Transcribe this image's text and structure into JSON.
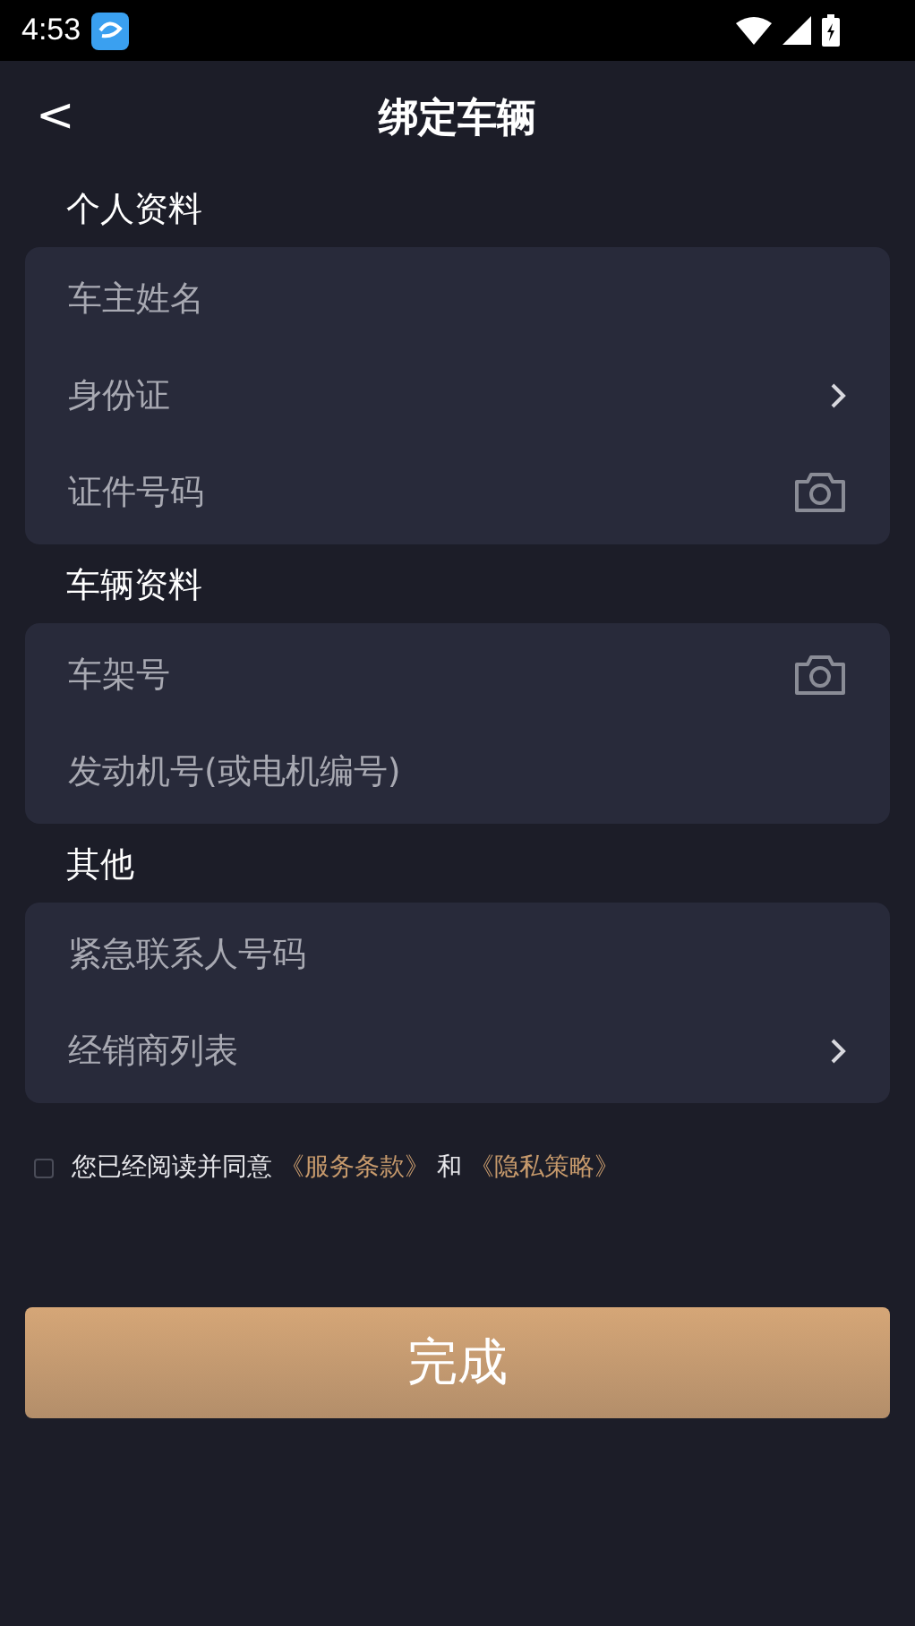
{
  "status_bar": {
    "time": "4:53"
  },
  "header": {
    "back": "<",
    "title": "绑定车辆"
  },
  "sections": [
    {
      "title": "个人资料",
      "rows": [
        {
          "kind": "text",
          "placeholder": "车主姓名"
        },
        {
          "kind": "chevron",
          "placeholder": "身份证"
        },
        {
          "kind": "camera",
          "placeholder": "证件号码"
        }
      ]
    },
    {
      "title": "车辆资料",
      "rows": [
        {
          "kind": "camera",
          "placeholder": "车架号"
        },
        {
          "kind": "text",
          "placeholder": "发动机号(或电机编号)"
        }
      ]
    },
    {
      "title": "其他",
      "rows": [
        {
          "kind": "text",
          "placeholder": "紧急联系人号码"
        },
        {
          "kind": "chevron",
          "placeholder": "经销商列表"
        }
      ]
    }
  ],
  "agreement": {
    "checked": false,
    "text": "您已经阅读并同意",
    "link1": "《服务条款》",
    "and": "和",
    "link2": "《隐私策略》"
  },
  "submit": "完成"
}
